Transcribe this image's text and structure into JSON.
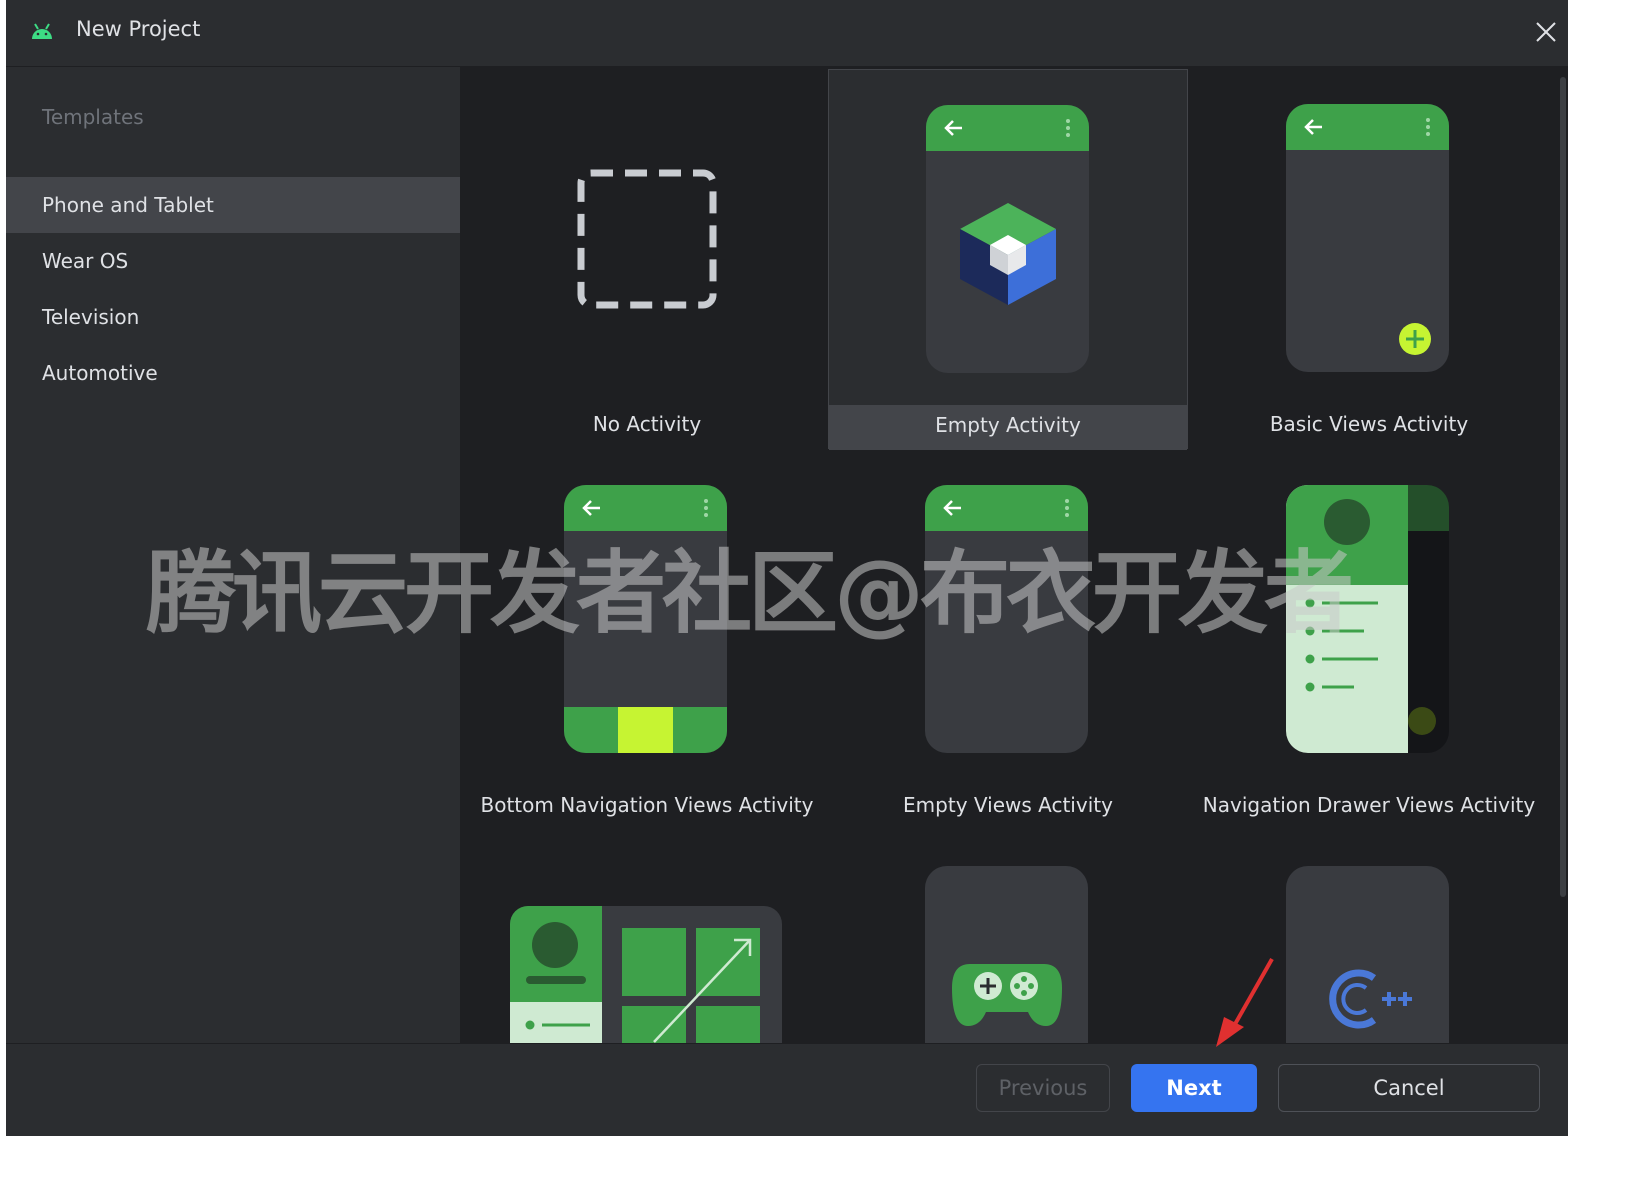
{
  "window": {
    "title": "New Project"
  },
  "sidebar": {
    "heading": "Templates",
    "items": [
      {
        "label": "Phone and Tablet",
        "selected": true
      },
      {
        "label": "Wear OS",
        "selected": false
      },
      {
        "label": "Television",
        "selected": false
      },
      {
        "label": "Automotive",
        "selected": false
      }
    ]
  },
  "templates": [
    {
      "label": "No Activity",
      "selected": false,
      "icon": "dashed-square-icon"
    },
    {
      "label": "Empty Activity",
      "selected": true,
      "icon": "compose-cube-icon"
    },
    {
      "label": "Basic Views Activity",
      "selected": false,
      "icon": "fab-plus-icon"
    },
    {
      "label": "Bottom Navigation Views Activity",
      "selected": false,
      "icon": "bottom-nav-icon"
    },
    {
      "label": "Empty Views Activity",
      "selected": false,
      "icon": "phone-icon"
    },
    {
      "label": "Navigation Drawer Views Activity",
      "selected": false,
      "icon": "nav-drawer-icon"
    },
    {
      "label": "",
      "icon": "responsive-layout-icon"
    },
    {
      "label": "",
      "icon": "gamepad-icon"
    },
    {
      "label": "",
      "icon": "cpp-icon"
    }
  ],
  "footer": {
    "previous": "Previous",
    "next": "Next",
    "cancel": "Cancel"
  },
  "watermark": "腾讯云开发者社区@布衣开发者",
  "colors": {
    "accent": "#3574f0",
    "android_green": "#3ea14a",
    "lime": "#c6f432",
    "background": "#1e1f22",
    "panel": "#2b2d30"
  }
}
